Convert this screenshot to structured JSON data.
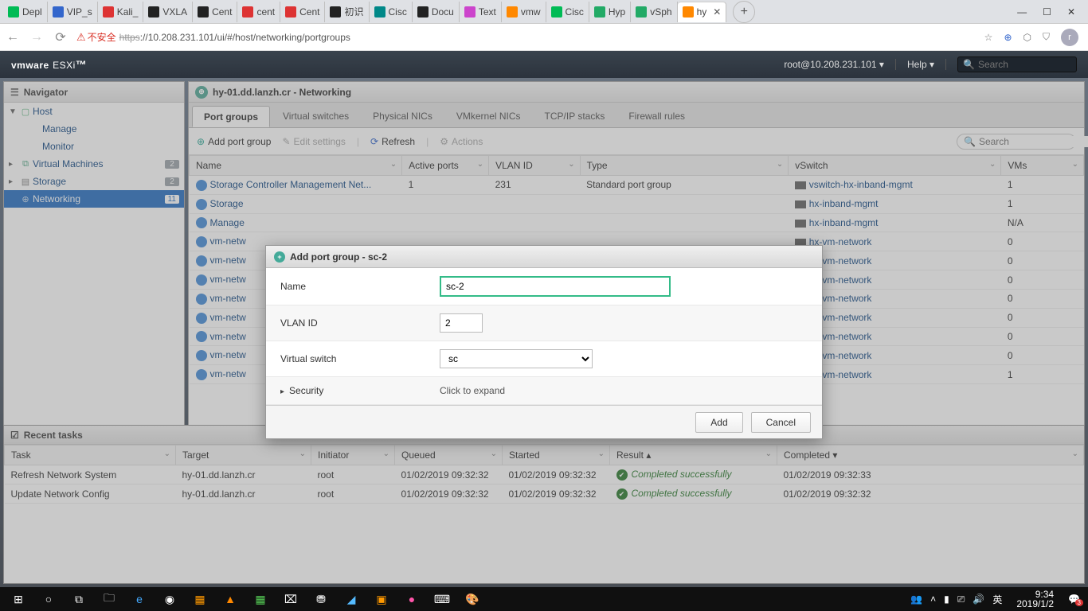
{
  "browser": {
    "tabs": [
      {
        "label": "Depl",
        "fc": "cisco"
      },
      {
        "label": "VIP_s",
        "fc": "blue"
      },
      {
        "label": "Kali_",
        "fc": "red"
      },
      {
        "label": "VXLA",
        "fc": "black"
      },
      {
        "label": "Cent",
        "fc": "black"
      },
      {
        "label": "cent",
        "fc": "red"
      },
      {
        "label": "Cent",
        "fc": "red"
      },
      {
        "label": "初识",
        "fc": "black"
      },
      {
        "label": "Cisc",
        "fc": "teal"
      },
      {
        "label": "Docu",
        "fc": "black"
      },
      {
        "label": "Text",
        "fc": "purple"
      },
      {
        "label": "vmw",
        "fc": "orange"
      },
      {
        "label": "Cisc",
        "fc": "cisco"
      },
      {
        "label": "Hyp",
        "fc": "green"
      },
      {
        "label": "vSph",
        "fc": "green"
      },
      {
        "label": "hy",
        "fc": "orange",
        "active": true
      }
    ],
    "insecure": "不安全",
    "url_strike": "https",
    "url_rest": "://10.208.231.101/ui/#/host/networking/portgroups",
    "avatar": "r"
  },
  "esxi": {
    "logo_a": "vmware",
    "logo_b": "ESXi",
    "user": "root@10.208.231.101 ▾",
    "help": "Help ▾",
    "search_ph": "Search"
  },
  "navigator": {
    "title": "Navigator",
    "host": "Host",
    "manage": "Manage",
    "monitor": "Monitor",
    "vm": "Virtual Machines",
    "vm_count": "2",
    "storage": "Storage",
    "storage_count": "2",
    "networking": "Networking",
    "net_count": "11"
  },
  "content": {
    "title": "hy-01.dd.lanzh.cr - Networking",
    "tabs": [
      "Port groups",
      "Virtual switches",
      "Physical NICs",
      "VMkernel NICs",
      "TCP/IP stacks",
      "Firewall rules"
    ],
    "toolbar": {
      "add": "Add port group",
      "edit": "Edit settings",
      "refresh": "Refresh",
      "actions": "Actions",
      "search_ph": "Search"
    },
    "cols": [
      "Name",
      "Active ports",
      "VLAN ID",
      "Type",
      "vSwitch",
      "VMs"
    ],
    "rows": [
      {
        "name": "Storage Controller Management Net...",
        "ap": "1",
        "vlan": "231",
        "type": "Standard port group",
        "vs": "vswitch-hx-inband-mgmt",
        "vms": "1"
      },
      {
        "name": "Storage",
        "ap": "",
        "vlan": "",
        "type": "",
        "vs": "hx-inband-mgmt",
        "vms": "1"
      },
      {
        "name": "Manage",
        "ap": "",
        "vlan": "",
        "type": "",
        "vs": "hx-inband-mgmt",
        "vms": "N/A"
      },
      {
        "name": "vm-netw",
        "ap": "",
        "vlan": "",
        "type": "",
        "vs": "hx-vm-network",
        "vms": "0"
      },
      {
        "name": "vm-netw",
        "ap": "",
        "vlan": "",
        "type": "",
        "vs": "hx-vm-network",
        "vms": "0"
      },
      {
        "name": "vm-netw",
        "ap": "",
        "vlan": "",
        "type": "",
        "vs": "hx-vm-network",
        "vms": "0"
      },
      {
        "name": "vm-netw",
        "ap": "",
        "vlan": "",
        "type": "",
        "vs": "hx-vm-network",
        "vms": "0"
      },
      {
        "name": "vm-netw",
        "ap": "",
        "vlan": "",
        "type": "",
        "vs": "hx-vm-network",
        "vms": "0"
      },
      {
        "name": "vm-netw",
        "ap": "",
        "vlan": "",
        "type": "",
        "vs": "hx-vm-network",
        "vms": "0"
      },
      {
        "name": "vm-netw",
        "ap": "",
        "vlan": "",
        "type": "",
        "vs": "hx-vm-network",
        "vms": "0"
      },
      {
        "name": "vm-netw",
        "ap": "",
        "vlan": "",
        "type": "",
        "vs": "hx-vm-network",
        "vms": "1"
      }
    ]
  },
  "modal": {
    "title": "Add port group - sc-2",
    "name_label": "Name",
    "name_value": "sc-2",
    "vlan_label": "VLAN ID",
    "vlan_value": "2",
    "vswitch_label": "Virtual switch",
    "vswitch_value": "sc",
    "security_label": "Security",
    "security_hint": "Click to expand",
    "btn_add": "Add",
    "btn_cancel": "Cancel"
  },
  "tasks": {
    "title": "Recent tasks",
    "cols": [
      "Task",
      "Target",
      "Initiator",
      "Queued",
      "Started",
      "Result ▴",
      "Completed ▾"
    ],
    "rows": [
      {
        "task": "Refresh Network System",
        "target": "hy-01.dd.lanzh.cr",
        "init": "root",
        "q": "01/02/2019 09:32:32",
        "s": "01/02/2019 09:32:32",
        "r": "Completed successfully",
        "c": "01/02/2019 09:32:33"
      },
      {
        "task": "Update Network Config",
        "target": "hy-01.dd.lanzh.cr",
        "init": "root",
        "q": "01/02/2019 09:32:32",
        "s": "01/02/2019 09:32:32",
        "r": "Completed successfully",
        "c": "01/02/2019 09:32:32"
      }
    ]
  },
  "taskbar": {
    "time": "9:34",
    "date": "2019/1/2",
    "ime": "英",
    "badge": "3"
  }
}
